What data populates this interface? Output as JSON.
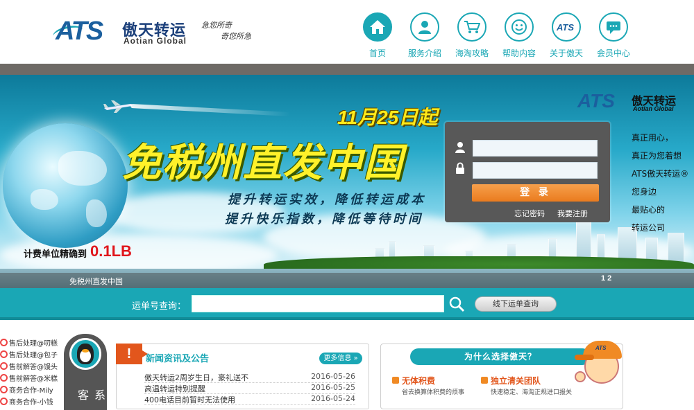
{
  "header": {
    "logo": {
      "ats": "ATS",
      "cn": "傲天转运",
      "en": "Aotian Global",
      "slogan1": "急您所奇",
      "slogan2": "奇您所急"
    },
    "nav": [
      {
        "label": "首页",
        "icon": "home-icon"
      },
      {
        "label": "服务介绍",
        "icon": "user-icon"
      },
      {
        "label": "海淘攻略",
        "icon": "cart-icon"
      },
      {
        "label": "帮助内容",
        "icon": "smile-icon"
      },
      {
        "label": "关于傲天",
        "icon": "ats-logo-icon"
      },
      {
        "label": "会员中心",
        "icon": "chat-icon"
      }
    ]
  },
  "banner": {
    "date": "11月25日起",
    "headline": "免税州直发中国",
    "line1": "提升转运实效，降低转运成本",
    "line2": "提升快乐指数，降低等待时间",
    "unit_label": "计费单位精确到",
    "unit_value": "0.1LB",
    "logo_ats": "ATS",
    "logo_cn": "傲天转运",
    "logo_en": "Aotian Global",
    "caption": "免税州直发中国",
    "pager": "1  2"
  },
  "login": {
    "username_placeholder": "",
    "password_placeholder": "",
    "submit": "登 录",
    "forgot": "忘记密码",
    "register": "我要注册"
  },
  "side_text": [
    "真正用心，",
    "真正为您着想",
    "ATS傲天转运®",
    "您身边",
    "最贴心的",
    "转运公司"
  ],
  "tracking": {
    "label": "运单号查询：",
    "placeholder": "",
    "offline_button": "线下运单查询"
  },
  "staff": [
    "售后处理@叨糕",
    "售后处理@包子",
    "售前解答@馒头",
    "售前解答@米糕",
    "商务合作-Mily",
    "商务合作-小钱"
  ],
  "contact_label": "联系客",
  "news": {
    "badge": "!",
    "title": "新闻资讯及公告",
    "more": "更多信息 »",
    "items": [
      {
        "title": "傲天转运2周岁生日，豪礼送不",
        "date": "2016-05-26"
      },
      {
        "title": "高温转运特别提醒",
        "date": "2016-05-25"
      },
      {
        "title": "400电话目前暂时无法使用",
        "date": "2016-05-24"
      }
    ]
  },
  "why": {
    "title": "为什么选择傲天？",
    "items": [
      {
        "title": "无体积费",
        "desc": "省去换算体积费的烦事"
      },
      {
        "title": "独立清关团队",
        "desc": "快速稳定、海淘正规进口报关"
      }
    ],
    "mascot_cap": "ATS"
  },
  "colors": {
    "primary": "#1aa7b5",
    "accent": "#e2561c",
    "button": "#ea7b1e"
  }
}
